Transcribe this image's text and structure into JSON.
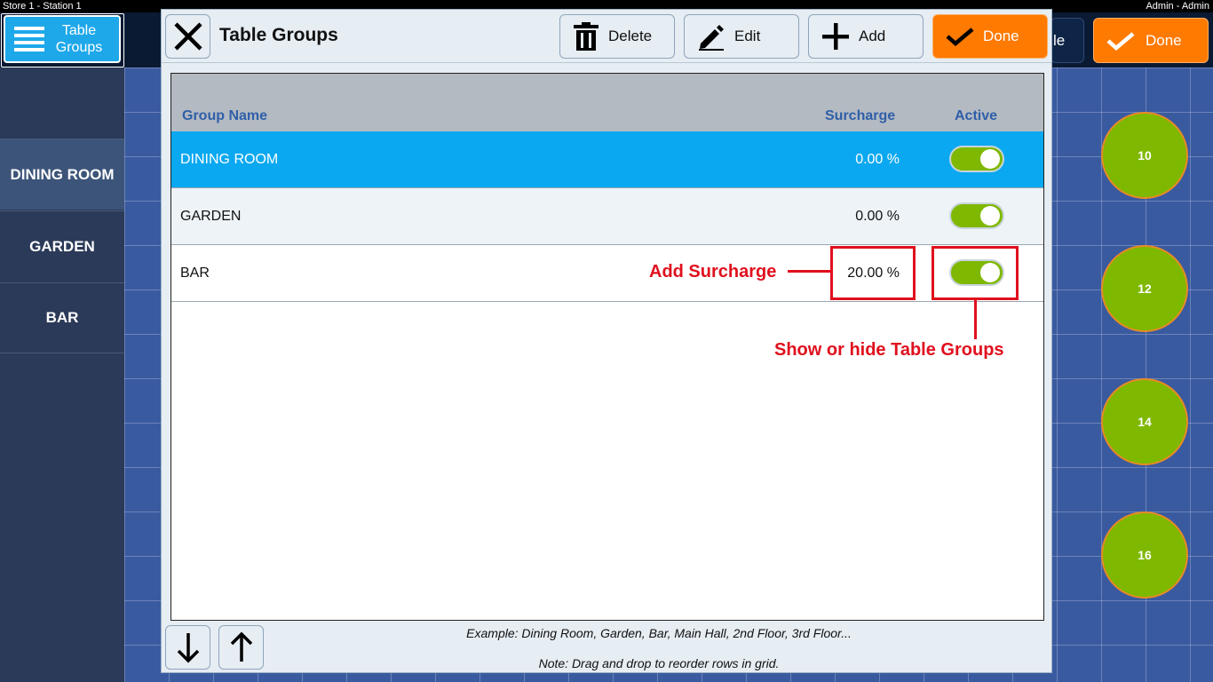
{
  "status_bar": {
    "left": "Store 1 - Station 1",
    "right": "Admin - Admin"
  },
  "app": {
    "table_groups_button": "Table\nGroups",
    "table_groups_line1": "Table",
    "table_groups_line2": "Groups",
    "partial_button_text": "le",
    "done_label": "Done",
    "sidebar": [
      {
        "label": "DINING ROOM",
        "active": true
      },
      {
        "label": "GARDEN",
        "active": false
      },
      {
        "label": "BAR",
        "active": false
      }
    ],
    "tables": [
      "10",
      "12",
      "14",
      "16"
    ],
    "table_color": "#7fb800"
  },
  "dialog": {
    "title": "Table Groups",
    "close_icon": "close-icon",
    "toolbar": {
      "delete_label": "Delete",
      "edit_label": "Edit",
      "add_label": "Add",
      "done_label": "Done"
    },
    "columns": {
      "name": "Group Name",
      "surcharge": "Surcharge",
      "active": "Active"
    },
    "rows": [
      {
        "name": "DINING ROOM",
        "surcharge": "0.00 %",
        "active": true,
        "selected": true
      },
      {
        "name": "GARDEN",
        "surcharge": "0.00 %",
        "active": true,
        "selected": false
      },
      {
        "name": "BAR",
        "surcharge": "20.00 %",
        "active": true,
        "selected": false
      }
    ],
    "example_note": "Example: Dining Room, Garden, Bar, Main Hall, 2nd Floor, 3rd Floor...",
    "drag_note": "Note: Drag and drop to reorder rows in grid."
  },
  "annotations": {
    "surcharge": "Add Surcharge",
    "toggle": "Show or hide Table Groups",
    "color": "#e0101e"
  },
  "colors": {
    "accent": "#0aa8f0",
    "done": "#ff7a00",
    "toggle_on": "#7fb800"
  }
}
